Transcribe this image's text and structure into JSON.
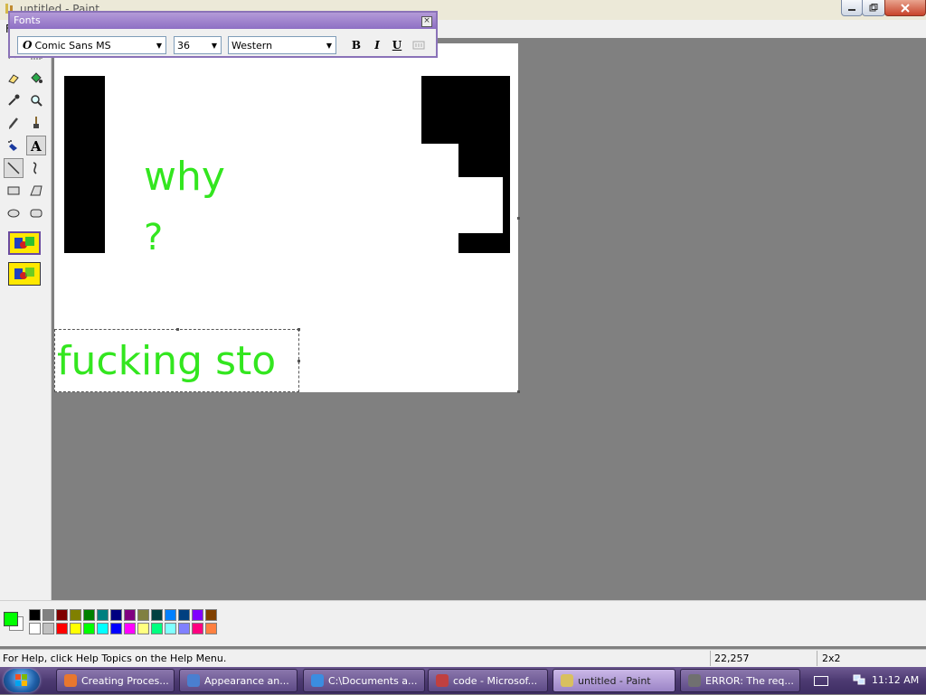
{
  "window": {
    "title": "untitled - Paint"
  },
  "menu": {
    "file_label": "F"
  },
  "fonts_toolbar": {
    "title": "Fonts",
    "font_name": "Comic Sans MS",
    "font_size": "36",
    "script": "Western",
    "bold_label": "B",
    "italic_label": "I",
    "underline_label": "U"
  },
  "canvas": {
    "text_why": "why",
    "text_q": "?",
    "text_box_content": "fucking sto",
    "text_color": "#33e61f"
  },
  "tools": [
    "free-form-select",
    "select",
    "eraser",
    "fill-with-color",
    "pick-color",
    "magnifier",
    "pencil",
    "brush",
    "airbrush",
    "text",
    "line",
    "curve",
    "rectangle",
    "polygon",
    "ellipse",
    "rounded-rectangle",
    "opaque-background",
    "transparent-background"
  ],
  "palette": {
    "foreground": "#00ff00",
    "background": "#ffffff",
    "top_row": [
      "#000000",
      "#808080",
      "#800000",
      "#808000",
      "#008000",
      "#008080",
      "#000080",
      "#800080",
      "#808040",
      "#004040",
      "#0080ff",
      "#004080",
      "#8000ff",
      "#804000"
    ],
    "bottom_row": [
      "#ffffff",
      "#c0c0c0",
      "#ff0000",
      "#ffff00",
      "#00ff00",
      "#00ffff",
      "#0000ff",
      "#ff00ff",
      "#ffff80",
      "#00ff80",
      "#80ffff",
      "#8080ff",
      "#ff0080",
      "#ff8040"
    ]
  },
  "status": {
    "help": "For Help, click Help Topics on the Help Menu.",
    "coords": "22,257",
    "size": "2x2"
  },
  "taskbar": {
    "items": [
      {
        "label": "Creating Proces...",
        "icon_color": "#e8772e"
      },
      {
        "label": "Appearance an...",
        "icon_color": "#4a7fd0"
      },
      {
        "label": "C:\\Documents a...",
        "icon_color": "#3b8de0"
      },
      {
        "label": "code - Microsof...",
        "icon_color": "#c04040"
      },
      {
        "label": "untitled - Paint",
        "icon_color": "#d8c060"
      },
      {
        "label": "ERROR: The req...",
        "icon_color": "#707070"
      }
    ],
    "clock": "11:12 AM"
  }
}
